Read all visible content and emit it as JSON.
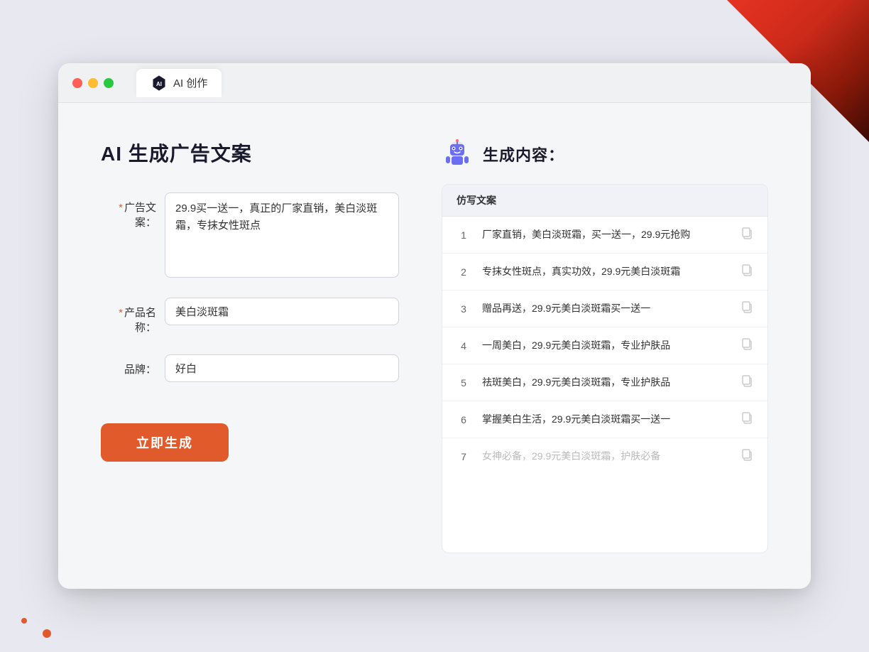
{
  "background": {
    "color": "#e8e8f0"
  },
  "browser": {
    "tab_label": "AI 创作",
    "tab_icon": "ai-icon"
  },
  "page": {
    "title": "AI 生成广告文案",
    "result_title": "生成内容："
  },
  "form": {
    "ad_copy_label": "广告文案：",
    "ad_copy_required": "*",
    "ad_copy_value": "29.9买一送一，真正的厂家直销，美白淡斑霜，专抹女性斑点",
    "product_name_label": "产品名称：",
    "product_name_required": "*",
    "product_name_value": "美白淡斑霜",
    "brand_label": "品牌：",
    "brand_value": "好白",
    "generate_button": "立即生成"
  },
  "results": {
    "column_header": "仿写文案",
    "items": [
      {
        "id": 1,
        "text": "厂家直销，美白淡斑霜，买一送一，29.9元抢购",
        "faded": false
      },
      {
        "id": 2,
        "text": "专抹女性斑点，真实功效，29.9元美白淡斑霜",
        "faded": false
      },
      {
        "id": 3,
        "text": "赠品再送，29.9元美白淡斑霜买一送一",
        "faded": false
      },
      {
        "id": 4,
        "text": "一周美白，29.9元美白淡斑霜，专业护肤品",
        "faded": false
      },
      {
        "id": 5,
        "text": "祛斑美白，29.9元美白淡斑霜，专业护肤品",
        "faded": false
      },
      {
        "id": 6,
        "text": "掌握美白生活，29.9元美白淡斑霜买一送一",
        "faded": false
      },
      {
        "id": 7,
        "text": "女神必备，29.9元美白淡斑霜，护肤必备",
        "faded": true
      }
    ]
  }
}
